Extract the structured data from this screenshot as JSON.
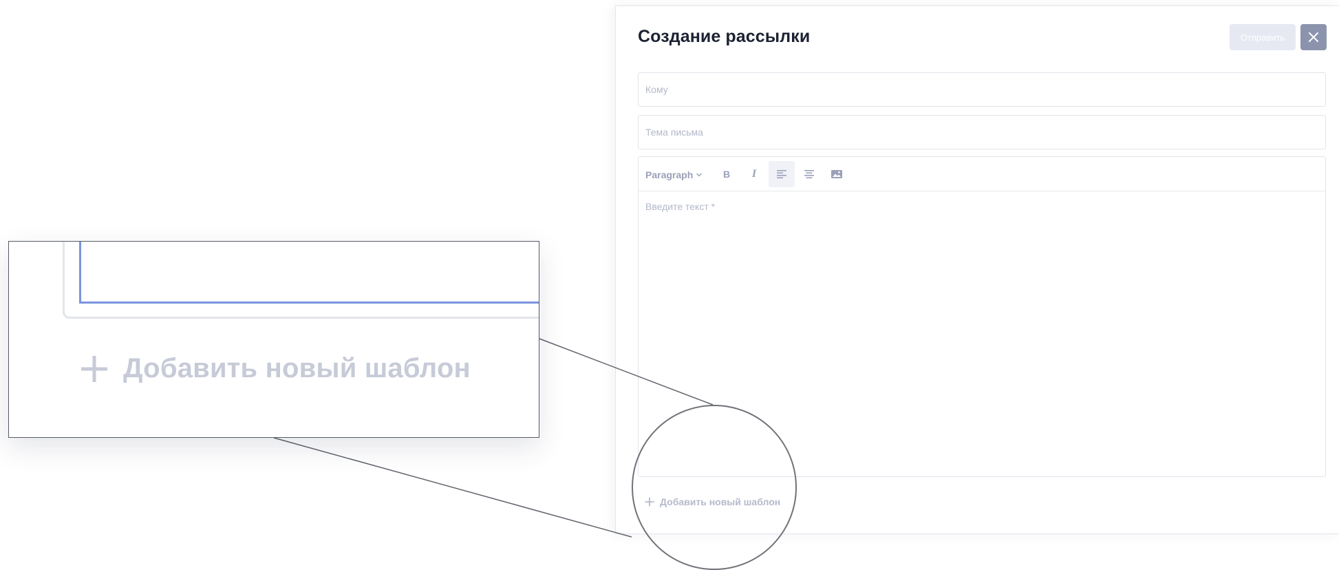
{
  "panel": {
    "title": "Создание рассылки",
    "send_label": "Отправить",
    "to_placeholder": "Кому",
    "subject_placeholder": "Тема письма"
  },
  "editor": {
    "paragraph_label": "Paragraph",
    "bold_label": "B",
    "italic_label": "I",
    "body_placeholder": "Введите текст *"
  },
  "add_template_label": "Добавить новый шаблон",
  "icons": {
    "close": "close-icon",
    "chevron": "chevron-down-icon",
    "align_left": "align-left-icon",
    "align_center": "align-center-icon",
    "image": "image-icon",
    "plus": "plus-icon"
  },
  "colors": {
    "title": "#1d2233",
    "send_disabled_bg": "#e6e9f2",
    "close_bg": "#8c94ad",
    "muted_text": "#b3b8c9",
    "toolbar_icon": "#9aa1b8",
    "focus_border": "#7b94dc"
  }
}
